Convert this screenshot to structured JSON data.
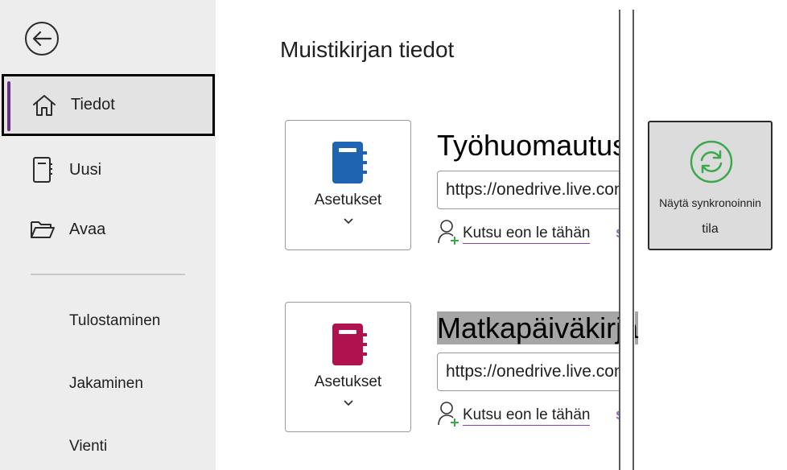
{
  "sidebar": {
    "nav": [
      {
        "label": "Tiedot"
      },
      {
        "label": "Uusi"
      },
      {
        "label": "Avaa"
      }
    ],
    "sub_items": [
      {
        "label": "Tulostaminen"
      },
      {
        "label": "Jakaminen"
      },
      {
        "label": "Vienti"
      }
    ]
  },
  "main": {
    "title": "Muistikirjan tiedot",
    "notebooks": [
      {
        "name": "Työhuomautus",
        "color": "#1f64b0",
        "options_label": "Asetukset",
        "url": "https://onedrive.live.com",
        "invite_label": "Kutsu eon le tähän",
        "share_glyph": "s"
      },
      {
        "name": "Matkapäiväkirja",
        "color": "#b0124f",
        "options_label": "Asetukset",
        "url": "https://onedrive.live.com",
        "invite_label": "Kutsu eon le tähän",
        "share_glyph": "s"
      }
    ]
  },
  "sync": {
    "line1": "Näytä synkronoinnin",
    "line2": "tila",
    "icon_color": "#3aa84b"
  },
  "colors": {
    "accent": "#6b2d8a",
    "sidebar_bg": "#ededed"
  }
}
